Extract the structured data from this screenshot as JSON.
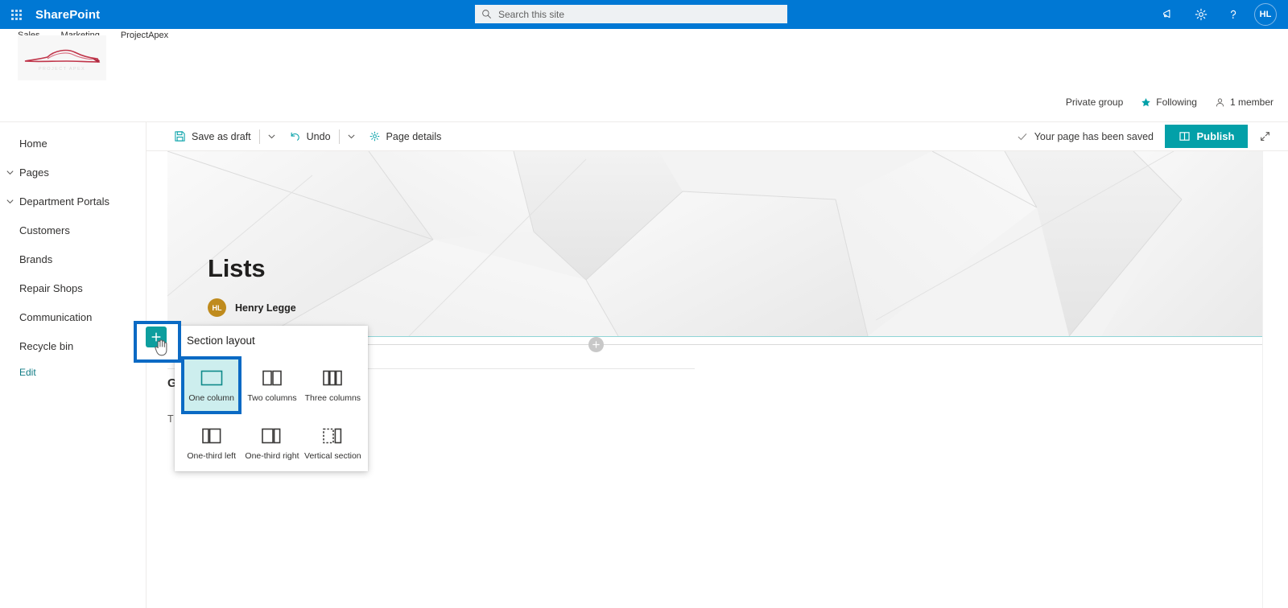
{
  "suite": {
    "waffle_icon": "app-launcher-icon",
    "brand": "SharePoint",
    "search": {
      "placeholder": "Search this site",
      "value": "",
      "icon": "search-icon"
    },
    "icons": [
      {
        "name": "megaphone-icon",
        "label": "What's new"
      },
      {
        "name": "gear-icon",
        "label": "Settings"
      },
      {
        "name": "help-icon",
        "label": "Help"
      }
    ],
    "avatar_initials": "HL"
  },
  "site_header": {
    "hub_nav": [
      {
        "label": "Sales"
      },
      {
        "label": "Marketing"
      },
      {
        "label": "ProjectApex"
      }
    ],
    "logo_alt": "car-silhouette-logo"
  },
  "site_meta": {
    "privacy": "Private group",
    "following": "Following",
    "following_icon": "star-icon",
    "members": "1 member",
    "members_icon": "person-icon"
  },
  "leftnav": {
    "items": [
      {
        "label": "Home",
        "expandable": false
      },
      {
        "label": "Pages",
        "expandable": true
      },
      {
        "label": "Department Portals",
        "expandable": true
      },
      {
        "label": "Customers",
        "expandable": false
      },
      {
        "label": "Brands",
        "expandable": false
      },
      {
        "label": "Repair Shops",
        "expandable": false
      },
      {
        "label": "Communication",
        "expandable": false
      },
      {
        "label": "Recycle bin",
        "expandable": false
      }
    ],
    "edit_label": "Edit"
  },
  "commandbar": {
    "save_label": "Save as draft",
    "save_icon": "save-icon",
    "undo_label": "Undo",
    "undo_icon": "undo-icon",
    "page_details_label": "Page details",
    "page_details_icon": "gear-icon",
    "caret_icon": "chevron-down-icon",
    "saved_status": "Your page has been saved",
    "saved_icon": "checkmark-icon",
    "publish_label": "Publish",
    "publish_icon": "publish-icon",
    "expand_icon": "expand-diagonal-icon"
  },
  "page": {
    "title": "Lists",
    "author_name": "Henry Legge",
    "author_initials": "HL",
    "webpart_heading": "G",
    "webpart_body": "T                                             he page is published.",
    "add_section_handle_icon": "plus-circle-icon"
  },
  "add_section": {
    "button_icon": "plus-icon",
    "cursor_icon": "hand-pointer-cursor"
  },
  "flyout": {
    "title": "Section layout",
    "options": [
      {
        "label": "One column",
        "icon": "one-column-icon",
        "selected": true
      },
      {
        "label": "Two columns",
        "icon": "two-columns-icon",
        "selected": false
      },
      {
        "label": "Three columns",
        "icon": "three-columns-icon",
        "selected": false
      },
      {
        "label": "One-third left",
        "icon": "one-third-left-icon",
        "selected": false
      },
      {
        "label": "One-third right",
        "icon": "one-third-right-icon",
        "selected": false
      },
      {
        "label": "Vertical section",
        "icon": "vertical-section-icon",
        "selected": false
      }
    ]
  },
  "colors": {
    "suite_blue": "#0078d4",
    "teal_accent": "#03a0a8",
    "highlight_blue": "#0b6ac4",
    "selected_fill": "#cdeeee",
    "avatar_gold": "#bf8b1d"
  }
}
